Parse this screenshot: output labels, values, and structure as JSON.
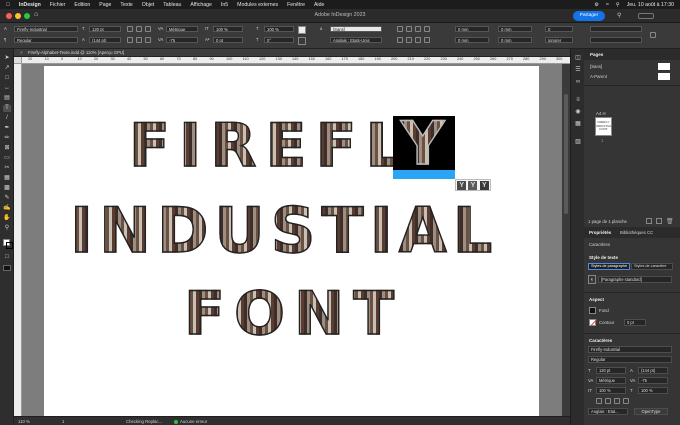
{
  "menubar": {
    "app_name": "InDesign",
    "items": [
      "Fichier",
      "Edition",
      "Page",
      "Texte",
      "Objet",
      "Tableau",
      "Affichage",
      "In5",
      "Modules externes",
      "Fenêtre",
      "Aide"
    ],
    "datetime": "Jeu. 10 août à 17:30"
  },
  "titlebar": {
    "title": "Adobe InDesign 2023",
    "share_label": "Partager"
  },
  "control_bar": {
    "font_family": "Firefly-Industrial",
    "font_style": "Regular",
    "font_size": "120 pt",
    "leading": "(144 pt)",
    "kerning": "Métrique",
    "tracking": "-75",
    "vertical_scale": "100 %",
    "horizontal_scale": "100 %",
    "baseline_shift": "0 pt",
    "skew": "0°",
    "char_style": "[Sans]",
    "language": "Anglais : Etats-Unis",
    "indent_values": [
      "0 mm",
      "0 mm",
      "0 mm",
      "0 mm"
    ],
    "para_extra": "0",
    "ignore": "Ignorer"
  },
  "document": {
    "tab_label": "Firefly-Alphabet-Texte.indd @ 110% [Aperçu GPU]",
    "headline_lines": [
      "FIREFL",
      "INDUSTIAL",
      "FONT"
    ],
    "selected_glyph": "Y",
    "glyph_alternates": [
      "Y",
      "Y",
      "Y"
    ],
    "hruler_marks": [
      "20",
      "10",
      "0",
      "10",
      "20",
      "30",
      "40",
      "50",
      "60",
      "70",
      "80",
      "90",
      "100",
      "110",
      "120",
      "130",
      "140",
      "150",
      "160",
      "170",
      "180",
      "190",
      "200",
      "210",
      "220",
      "230",
      "240",
      "250",
      "260",
      "270",
      "280",
      "290",
      "300"
    ]
  },
  "status_bar": {
    "zoom": "110 %",
    "page_number": "1",
    "status_text": "Checking Replac...",
    "preflight": "Aucune erreur"
  },
  "pages_panel": {
    "tab": "Pages",
    "items": [
      "[Sans]",
      "A-Parent"
    ],
    "master_label": "A4 H",
    "thumbnail_text": "FIREFLY INDUSTIAL FONT",
    "page_num": "1",
    "footer": "1 page de 1 planche"
  },
  "properties_panel": {
    "tabs": [
      "Propriétés",
      "Bibliothèques CC"
    ],
    "context": "Caractères",
    "section_text_style": "Style de texte",
    "style_buttons": [
      "Styles de paragraphe",
      "Styles de caractère"
    ],
    "para_style_value": "[Paragraphe standard]",
    "section_appearance": "Aspect",
    "fill_label": "Fond",
    "stroke_label": "Contour",
    "stroke_weight": "0 pt",
    "section_character": "Caractères",
    "font_family": "Firefly-Industrial",
    "font_style": "Regular",
    "font_size": "120 pt",
    "leading": "(144 pt)",
    "kerning": "Métrique",
    "tracking": "-75",
    "vscale": "100 %",
    "hscale": "100 %",
    "language": "Anglais : Etat...",
    "opentype_label": "OpenType"
  }
}
